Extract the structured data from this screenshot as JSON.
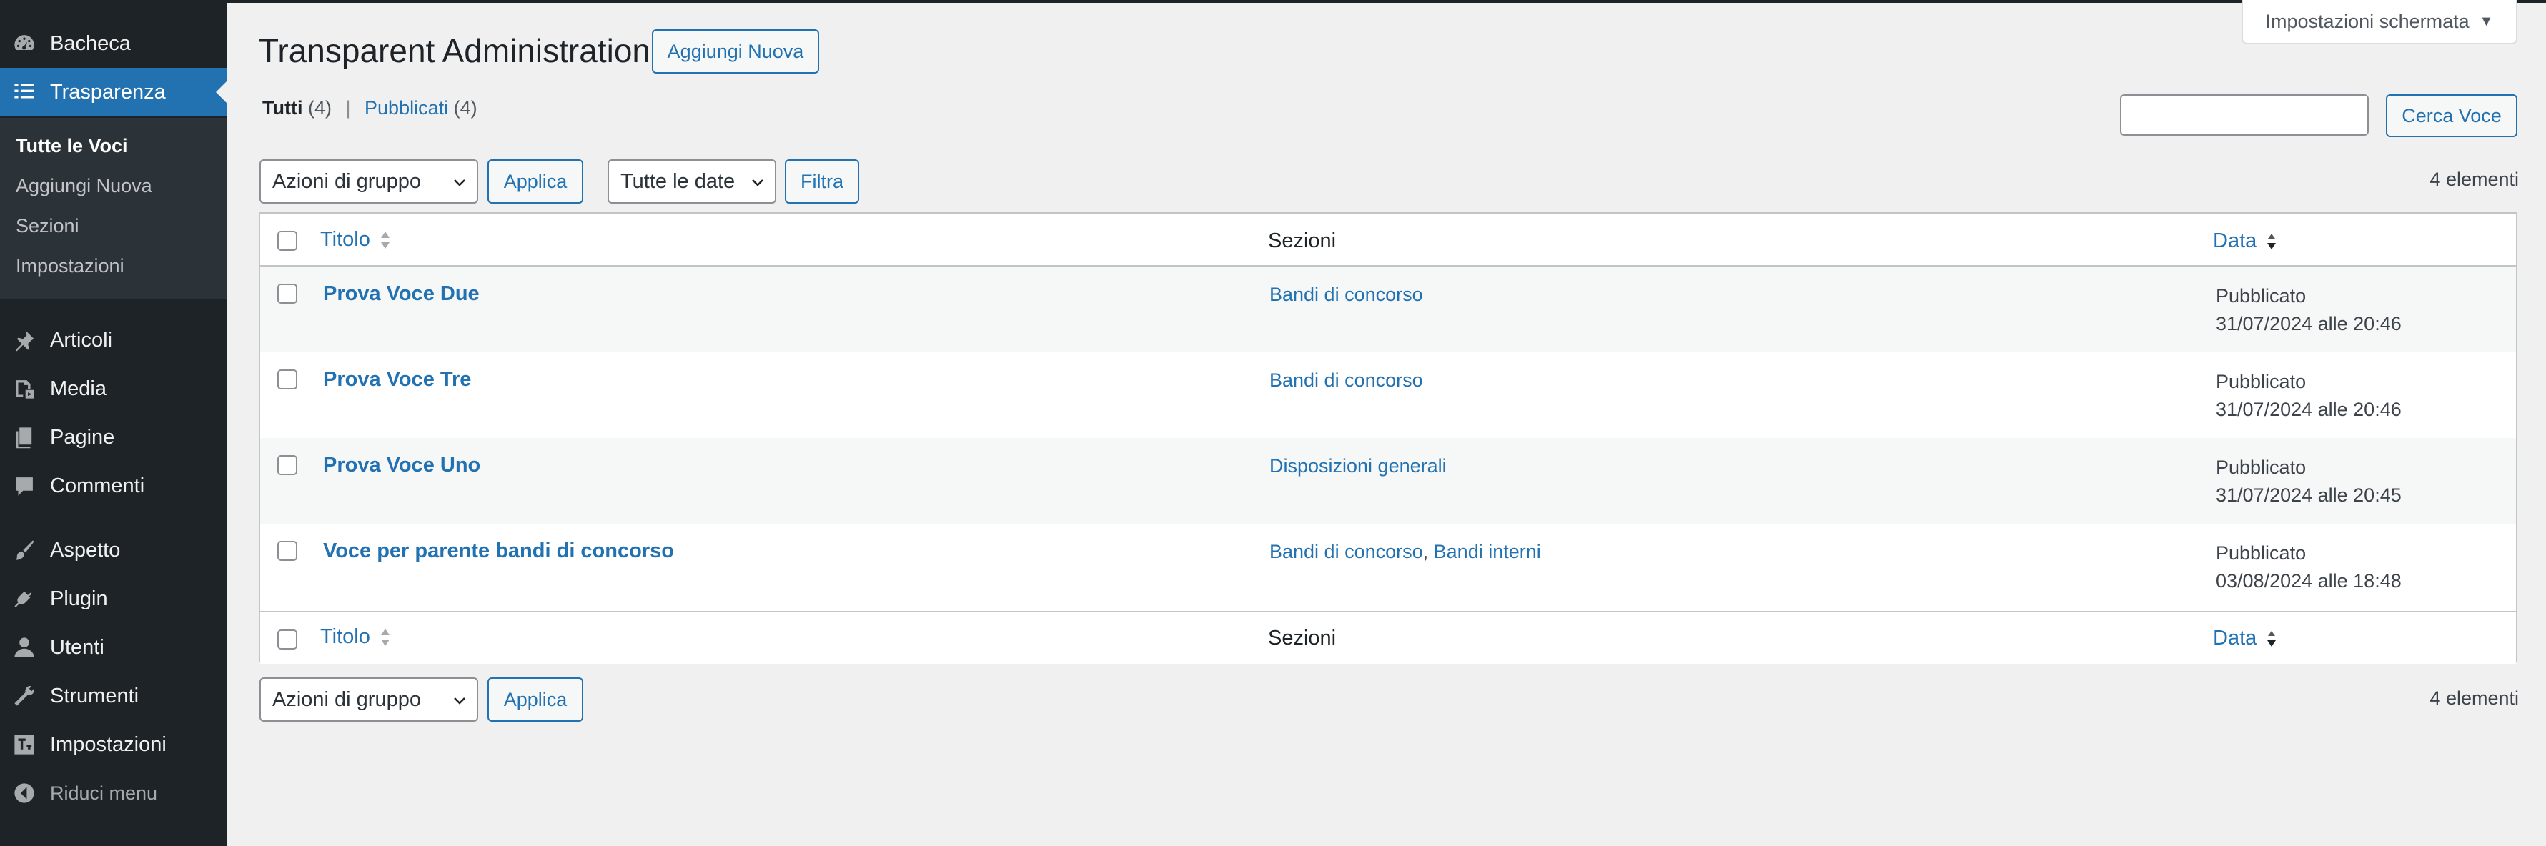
{
  "sidebar": {
    "items": [
      {
        "label": "Bacheca",
        "icon": "dashboard-icon"
      },
      {
        "label": "Trasparenza",
        "icon": "list-icon"
      },
      {
        "label": "Articoli",
        "icon": "pin-icon"
      },
      {
        "label": "Media",
        "icon": "media-icon"
      },
      {
        "label": "Pagine",
        "icon": "page-icon"
      },
      {
        "label": "Commenti",
        "icon": "comment-icon"
      },
      {
        "label": "Aspetto",
        "icon": "brush-icon"
      },
      {
        "label": "Plugin",
        "icon": "plug-icon"
      },
      {
        "label": "Utenti",
        "icon": "user-icon"
      },
      {
        "label": "Strumenti",
        "icon": "wrench-icon"
      },
      {
        "label": "Impostazioni",
        "icon": "settings-icon"
      }
    ],
    "submenu": [
      "Tutte le Voci",
      "Aggiungi Nuova",
      "Sezioni",
      "Impostazioni"
    ],
    "collapse_label": "Riduci menu"
  },
  "header": {
    "title": "Transparent Administration",
    "add_new": "Aggiungi Nuova",
    "screen_options": "Impostazioni schermata"
  },
  "views": {
    "all_label": "Tutti",
    "all_count": "(4)",
    "separator": "|",
    "published_label": "Pubblicati",
    "published_count": "(4)"
  },
  "search": {
    "value": "",
    "button": "Cerca Voce"
  },
  "filters": {
    "bulk_actions": "Azioni di gruppo",
    "apply": "Applica",
    "dates": "Tutte le date",
    "filter": "Filtra",
    "items_count": "4 elementi"
  },
  "table": {
    "columns": {
      "title": "Titolo",
      "sections": "Sezioni",
      "date": "Data"
    },
    "rows": [
      {
        "title": "Prova Voce Due",
        "sections": [
          "Bandi di concorso"
        ],
        "status": "Pubblicato",
        "date": "31/07/2024 alle 20:46"
      },
      {
        "title": "Prova Voce Tre",
        "sections": [
          "Bandi di concorso"
        ],
        "status": "Pubblicato",
        "date": "31/07/2024 alle 20:46"
      },
      {
        "title": "Prova Voce Uno",
        "sections": [
          "Disposizioni generali"
        ],
        "status": "Pubblicato",
        "date": "31/07/2024 alle 20:45"
      },
      {
        "title": "Voce per parente bandi di concorso",
        "sections": [
          "Bandi di concorso",
          "Bandi interni"
        ],
        "status": "Pubblicato",
        "date": "03/08/2024 alle 18:48"
      }
    ]
  },
  "colors": {
    "accent": "#2271b1",
    "sidebar_bg": "#1d2327",
    "submenu_bg": "#2c3338",
    "page_bg": "#f0f0f1"
  }
}
